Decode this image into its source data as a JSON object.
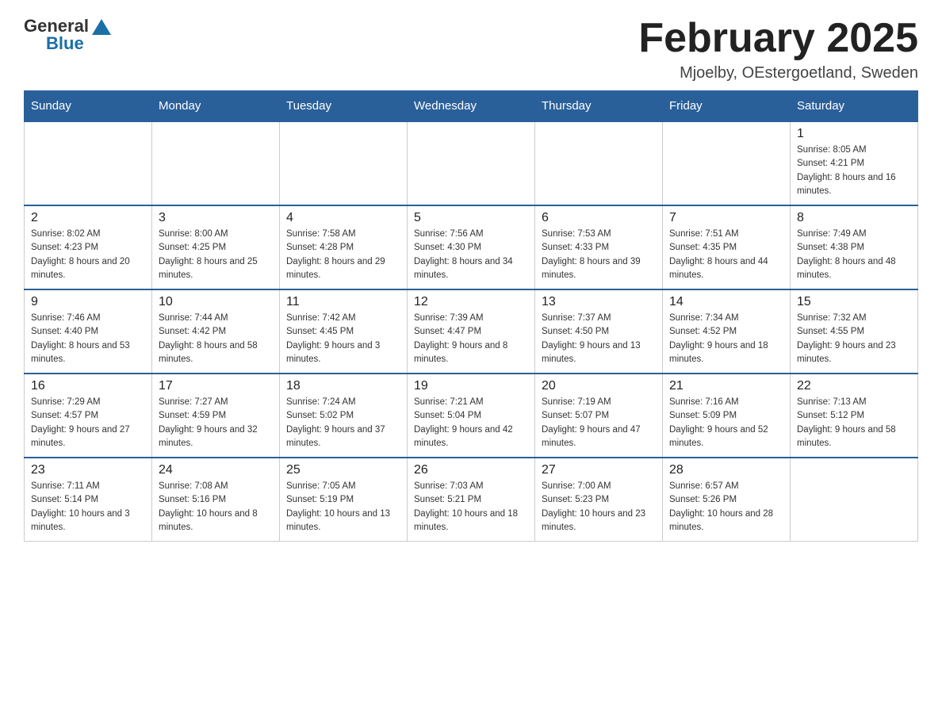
{
  "header": {
    "logo": {
      "general": "General",
      "blue": "Blue"
    },
    "title": "February 2025",
    "location": "Mjoelby, OEstergoetland, Sweden"
  },
  "calendar": {
    "days_of_week": [
      "Sunday",
      "Monday",
      "Tuesday",
      "Wednesday",
      "Thursday",
      "Friday",
      "Saturday"
    ],
    "weeks": [
      [
        {
          "day": "",
          "info": ""
        },
        {
          "day": "",
          "info": ""
        },
        {
          "day": "",
          "info": ""
        },
        {
          "day": "",
          "info": ""
        },
        {
          "day": "",
          "info": ""
        },
        {
          "day": "",
          "info": ""
        },
        {
          "day": "1",
          "info": "Sunrise: 8:05 AM\nSunset: 4:21 PM\nDaylight: 8 hours and 16 minutes."
        }
      ],
      [
        {
          "day": "2",
          "info": "Sunrise: 8:02 AM\nSunset: 4:23 PM\nDaylight: 8 hours and 20 minutes."
        },
        {
          "day": "3",
          "info": "Sunrise: 8:00 AM\nSunset: 4:25 PM\nDaylight: 8 hours and 25 minutes."
        },
        {
          "day": "4",
          "info": "Sunrise: 7:58 AM\nSunset: 4:28 PM\nDaylight: 8 hours and 29 minutes."
        },
        {
          "day": "5",
          "info": "Sunrise: 7:56 AM\nSunset: 4:30 PM\nDaylight: 8 hours and 34 minutes."
        },
        {
          "day": "6",
          "info": "Sunrise: 7:53 AM\nSunset: 4:33 PM\nDaylight: 8 hours and 39 minutes."
        },
        {
          "day": "7",
          "info": "Sunrise: 7:51 AM\nSunset: 4:35 PM\nDaylight: 8 hours and 44 minutes."
        },
        {
          "day": "8",
          "info": "Sunrise: 7:49 AM\nSunset: 4:38 PM\nDaylight: 8 hours and 48 minutes."
        }
      ],
      [
        {
          "day": "9",
          "info": "Sunrise: 7:46 AM\nSunset: 4:40 PM\nDaylight: 8 hours and 53 minutes."
        },
        {
          "day": "10",
          "info": "Sunrise: 7:44 AM\nSunset: 4:42 PM\nDaylight: 8 hours and 58 minutes."
        },
        {
          "day": "11",
          "info": "Sunrise: 7:42 AM\nSunset: 4:45 PM\nDaylight: 9 hours and 3 minutes."
        },
        {
          "day": "12",
          "info": "Sunrise: 7:39 AM\nSunset: 4:47 PM\nDaylight: 9 hours and 8 minutes."
        },
        {
          "day": "13",
          "info": "Sunrise: 7:37 AM\nSunset: 4:50 PM\nDaylight: 9 hours and 13 minutes."
        },
        {
          "day": "14",
          "info": "Sunrise: 7:34 AM\nSunset: 4:52 PM\nDaylight: 9 hours and 18 minutes."
        },
        {
          "day": "15",
          "info": "Sunrise: 7:32 AM\nSunset: 4:55 PM\nDaylight: 9 hours and 23 minutes."
        }
      ],
      [
        {
          "day": "16",
          "info": "Sunrise: 7:29 AM\nSunset: 4:57 PM\nDaylight: 9 hours and 27 minutes."
        },
        {
          "day": "17",
          "info": "Sunrise: 7:27 AM\nSunset: 4:59 PM\nDaylight: 9 hours and 32 minutes."
        },
        {
          "day": "18",
          "info": "Sunrise: 7:24 AM\nSunset: 5:02 PM\nDaylight: 9 hours and 37 minutes."
        },
        {
          "day": "19",
          "info": "Sunrise: 7:21 AM\nSunset: 5:04 PM\nDaylight: 9 hours and 42 minutes."
        },
        {
          "day": "20",
          "info": "Sunrise: 7:19 AM\nSunset: 5:07 PM\nDaylight: 9 hours and 47 minutes."
        },
        {
          "day": "21",
          "info": "Sunrise: 7:16 AM\nSunset: 5:09 PM\nDaylight: 9 hours and 52 minutes."
        },
        {
          "day": "22",
          "info": "Sunrise: 7:13 AM\nSunset: 5:12 PM\nDaylight: 9 hours and 58 minutes."
        }
      ],
      [
        {
          "day": "23",
          "info": "Sunrise: 7:11 AM\nSunset: 5:14 PM\nDaylight: 10 hours and 3 minutes."
        },
        {
          "day": "24",
          "info": "Sunrise: 7:08 AM\nSunset: 5:16 PM\nDaylight: 10 hours and 8 minutes."
        },
        {
          "day": "25",
          "info": "Sunrise: 7:05 AM\nSunset: 5:19 PM\nDaylight: 10 hours and 13 minutes."
        },
        {
          "day": "26",
          "info": "Sunrise: 7:03 AM\nSunset: 5:21 PM\nDaylight: 10 hours and 18 minutes."
        },
        {
          "day": "27",
          "info": "Sunrise: 7:00 AM\nSunset: 5:23 PM\nDaylight: 10 hours and 23 minutes."
        },
        {
          "day": "28",
          "info": "Sunrise: 6:57 AM\nSunset: 5:26 PM\nDaylight: 10 hours and 28 minutes."
        },
        {
          "day": "",
          "info": ""
        }
      ]
    ]
  }
}
